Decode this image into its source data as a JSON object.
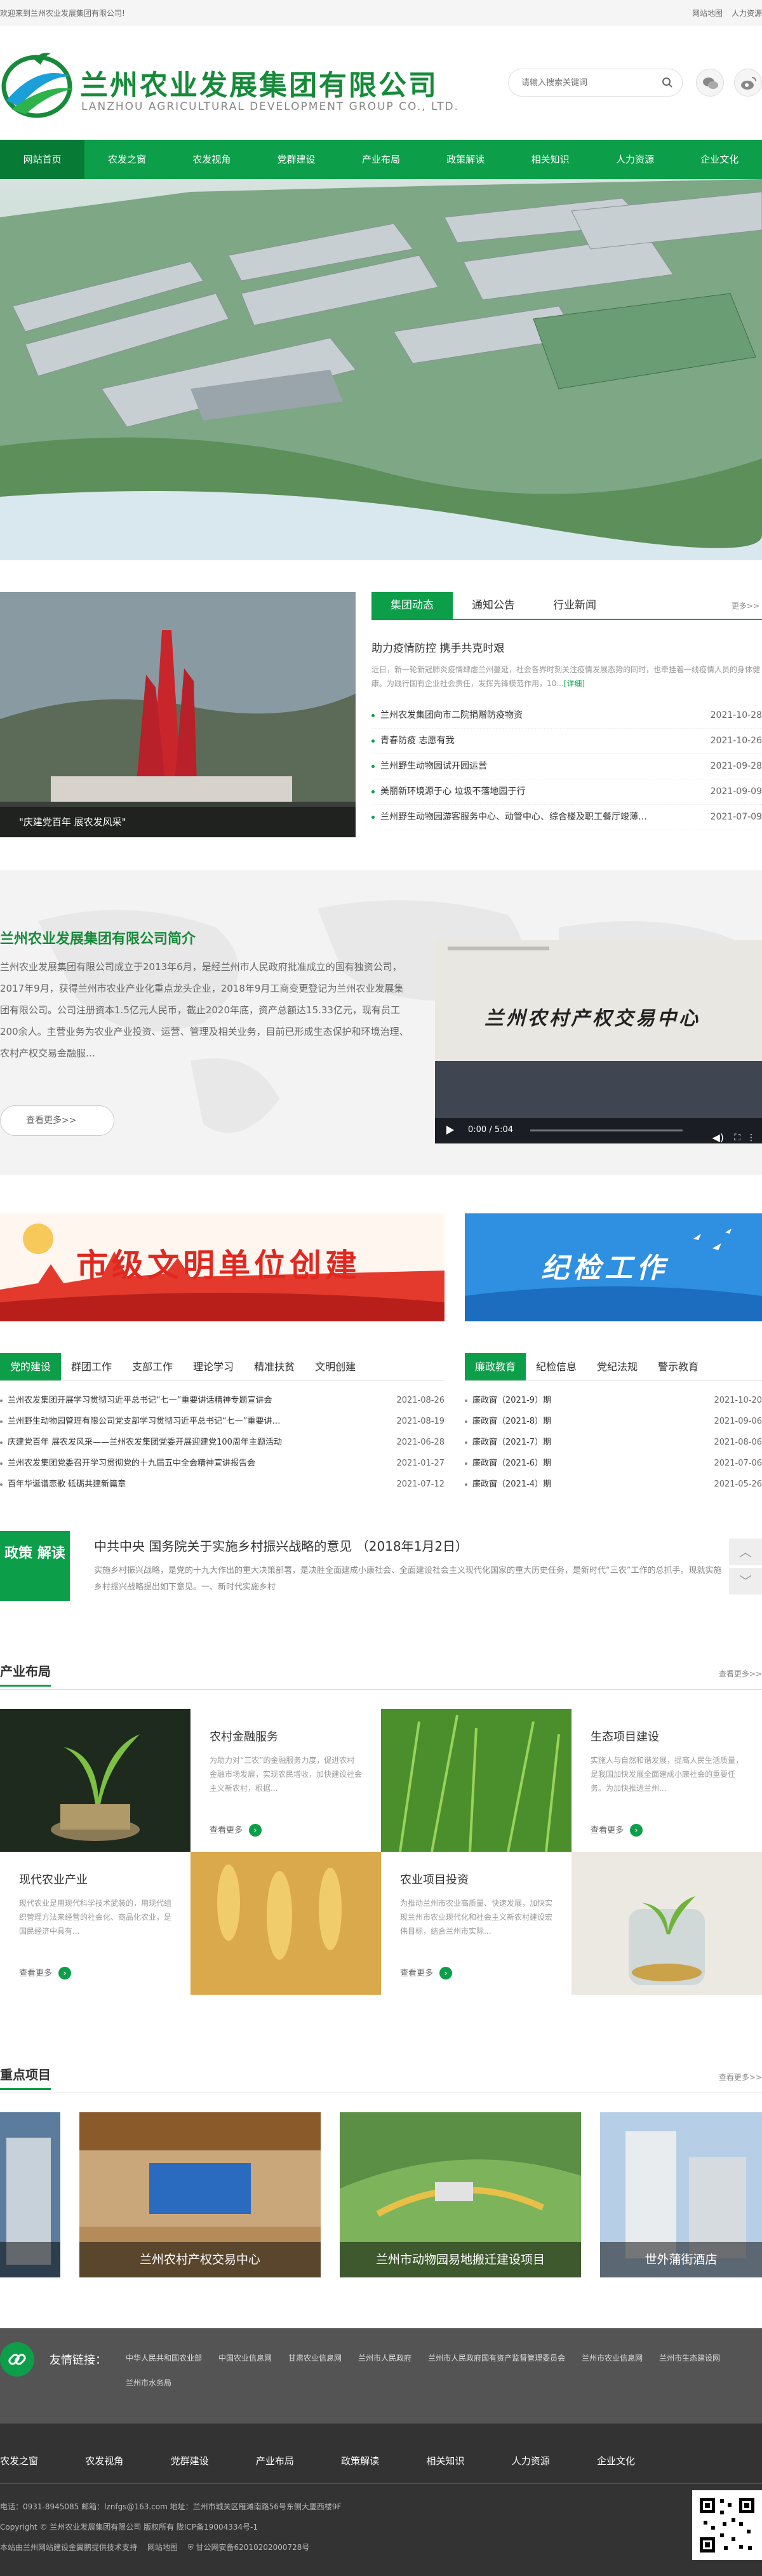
{
  "topbar": {
    "welcome": "欢迎来到兰州农业发展集团有限公司!",
    "links": [
      "网站地图",
      "人力资源"
    ]
  },
  "header": {
    "name_cn": "兰州农业发展集团有限公司",
    "name_en": "LANZHOU AGRICULTURAL DEVELOPMENT GROUP CO., LTD."
  },
  "search": {
    "placeholder": "请输入搜索关键词"
  },
  "nav": [
    "网站首页",
    "农发之窗",
    "农发视角",
    "党群建设",
    "产业布局",
    "政策解读",
    "相关知识",
    "人力资源",
    "企业文化"
  ],
  "news": {
    "image_caption": "\"庆建党百年 展农发风采\"",
    "tabs": [
      "集团动态",
      "通知公告",
      "行业新闻"
    ],
    "more": "更多>>",
    "featured_title": "助力疫情防控 携手共克时艰",
    "featured_summary": "近日，新一轮新冠肺炎疫情肆虐兰州蔓延，社会各界时刻关注疫情发展态势的同时，也牵挂着一线疫情人员的身体健康。为践行国有企业社会责任，发挥先锋模范作用，10...",
    "detail": "[详细]",
    "items": [
      {
        "title": "兰州农发集团向市二院捐赠防疫物资",
        "date": "2021-10-28"
      },
      {
        "title": "青春防疫 志愿有我",
        "date": "2021-10-26"
      },
      {
        "title": "兰州野生动物园试开园运营",
        "date": "2021-09-28"
      },
      {
        "title": "美丽新环境源于心 垃圾不落地园于行",
        "date": "2021-09-09"
      },
      {
        "title": "兰州野生动物园游客服务中心、动管中心、综合楼及职工餐厅竣薄…",
        "date": "2021-07-09"
      }
    ]
  },
  "intro": {
    "title": "兰州农业发展集团有限公司简介",
    "text": "兰州农业发展集团有限公司成立于2013年6月，是经兰州市人民政府批准成立的国有独资公司，2017年9月，获得兰州市农业产业化重点龙头企业，2018年9月工商变更登记为兰州农业发展集团有限公司。公司注册资本1.5亿元人民币，截止2020年底，资产总额达15.33亿元，现有员工200余人。主营业务为农业产业投资、运营、管理及相关业务，目前已形成生态保护和环境治理、农村产权交易金融服…",
    "more": "查看更多>>",
    "video_sign": "兰州农村产权交易中心",
    "video_time": "0:00 / 5:04"
  },
  "promos": [
    {
      "title": "市级文明单位创建"
    },
    {
      "title": "纪检工作"
    }
  ],
  "party": {
    "tabs": [
      "党的建设",
      "群团工作",
      "支部工作",
      "理论学习",
      "精准扶贫",
      "文明创建"
    ],
    "items": [
      {
        "title": "兰州农发集团开展学习贯彻习近平总书记“七一”重要讲话精神专题宣讲会",
        "date": "2021-08-26"
      },
      {
        "title": "兰州野生动物园管理有限公司党支部学习贯彻习近平总书记“七一”重要讲…",
        "date": "2021-08-19"
      },
      {
        "title": "庆建党百年 展农发风采——兰州农发集团党委开展迎建党100周年主题活动",
        "date": "2021-06-28"
      },
      {
        "title": "兰州农发集团党委召开学习贯彻党的十九届五中全会精神宣讲报告会",
        "date": "2021-01-27"
      },
      {
        "title": "百年华诞谱恋歌 砥砺共建新篇章",
        "date": "2021-07-12"
      }
    ]
  },
  "clean": {
    "tabs": [
      "廉政教育",
      "纪检信息",
      "党纪法规",
      "警示教育"
    ],
    "items": [
      {
        "title": "廉政窗（2021-9）期",
        "date": "2021-10-20"
      },
      {
        "title": "廉政窗（2021-8）期",
        "date": "2021-09-06"
      },
      {
        "title": "廉政窗（2021-7）期",
        "date": "2021-08-06"
      },
      {
        "title": "廉政窗（2021-6）期",
        "date": "2021-07-06"
      },
      {
        "title": "廉政窗（2021-4）期",
        "date": "2021-05-26"
      }
    ]
  },
  "policy": {
    "badge": "政策 解读",
    "title": "中共中央 国务院关于实施乡村振兴战略的意见 （2018年1月2日）",
    "text": "实施乡村振兴战略，是党的十九大作出的重大决策部署，是决胜全面建成小康社会、全面建设社会主义现代化国家的重大历史任务，是新时代“三农”工作的总抓手。现就实施乡村振兴战略提出如下意见。一、新时代实施乡村"
  },
  "industry": {
    "title": "产业布局",
    "more": "查看更多>>",
    "cells": [
      {
        "title": "农村金融服务",
        "desc": "为助力对“三农”的金融服务力度，促进农村金融市场发展，实现农民增收，加快建设社会主义新农村，根据...",
        "more": "查看更多"
      },
      {
        "title": "生态项目建设",
        "desc": "实施人与自然和谐发展，提高人民生活质量，是我国加快发展全面建成小康社会的重要任务。为加快推进兰州...",
        "more": "查看更多"
      },
      {
        "title": "现代农业产业",
        "desc": "现代农业是用现代科学技术武装的，用现代组织管理方法来经营的社会化、商品化农业，是国民经济中具有...",
        "more": "查看更多"
      },
      {
        "title": "农业项目投资",
        "desc": "为推动兰州市农业高质量、快速发展，加快实现兰州市农业现代化和社会主义新农村建设宏伟目标，结合兰州市实际...",
        "more": "查看更多"
      }
    ]
  },
  "projects": {
    "title": "重点项目",
    "more": "查看更多>>",
    "items": [
      "",
      "兰州农村产权交易中心",
      "兰州市动物园易地搬迁建设项目",
      "世外蒲街酒店"
    ]
  },
  "links": {
    "label": "友情链接：",
    "items": [
      "中华人民共和国农业部",
      "中国农业信息网",
      "甘肃农业信息网",
      "兰州市人民政府",
      "兰州市人民政府国有资产监督管理委员会",
      "兰州市农业信息网",
      "兰州市生态建设网",
      "兰州市水务局"
    ]
  },
  "footer": {
    "nav": [
      "农发之窗",
      "农发视角",
      "党群建设",
      "产业布局",
      "政策解读",
      "相关知识",
      "人力资源",
      "企业文化"
    ],
    "contact": "电话：0931-8945085 邮箱：lznfgs@163.com 地址：兰州市城关区雁滩南路56号东侧大厦西楼9F",
    "copyright": "Copyright © 兰州农业发展集团有限公司 版权所有 陇ICP备19004334号-1",
    "support": "本站由兰州网站建设金翼鹏提供技术支持",
    "sitemap": "网站地图",
    "police": "甘公网安备62010202000728号"
  }
}
